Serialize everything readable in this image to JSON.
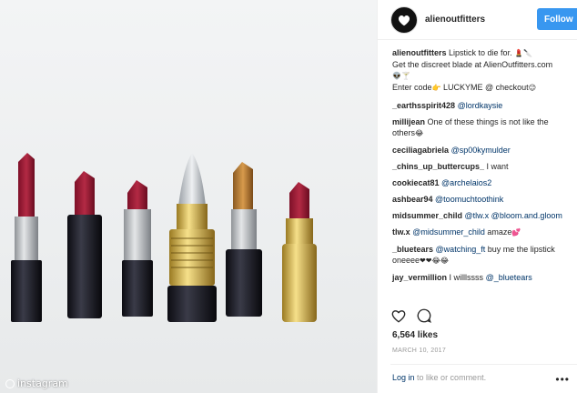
{
  "post": {
    "username": "alienoutfitters",
    "follow_label": "Follow",
    "watermark": "instagram",
    "caption_user": "alienoutfitters",
    "caption_text_1": "Lipstick to die for.",
    "caption_text_2": "Get the discreet blade at AlienOutfitters.com",
    "caption_text_3": "Enter code",
    "caption_code": "LUCKYME @ checkout",
    "likes": "6,564 likes",
    "date": "MARCH 10, 2017",
    "login_link": "Log in",
    "login_rest": "to like or comment."
  },
  "comments": [
    {
      "user": "_earthsspirit428",
      "mention": "@lordkaysie",
      "text": ""
    },
    {
      "user": "millijean",
      "mention": "",
      "text": "One of these things is not like the others"
    },
    {
      "user": "ceciliagabriela",
      "mention": "@sp00kymulder",
      "text": ""
    },
    {
      "user": "_chins_up_buttercups_",
      "mention": "",
      "text": "I want"
    },
    {
      "user": "cookiecat81",
      "mention": "@archelaios2",
      "text": ""
    },
    {
      "user": "ashbear94",
      "mention": "@toomuchtoothink",
      "text": ""
    },
    {
      "user": "midsummer_child",
      "mention": "@tlw.x @bloom.and.gloom",
      "text": ""
    },
    {
      "user": "tlw.x",
      "mention": "@midsummer_child",
      "text": "amaze"
    },
    {
      "user": "_bluetears",
      "mention": "@watching_ft",
      "text": "buy me the lipstick oneeee"
    },
    {
      "user": "jay_vermillion",
      "mention": "",
      "text": "I willlssss"
    },
    {
      "user": "",
      "mention": "@_bluetears",
      "text": ""
    }
  ],
  "colors": {
    "follow_bg": "#3897f0",
    "link": "#003569"
  }
}
